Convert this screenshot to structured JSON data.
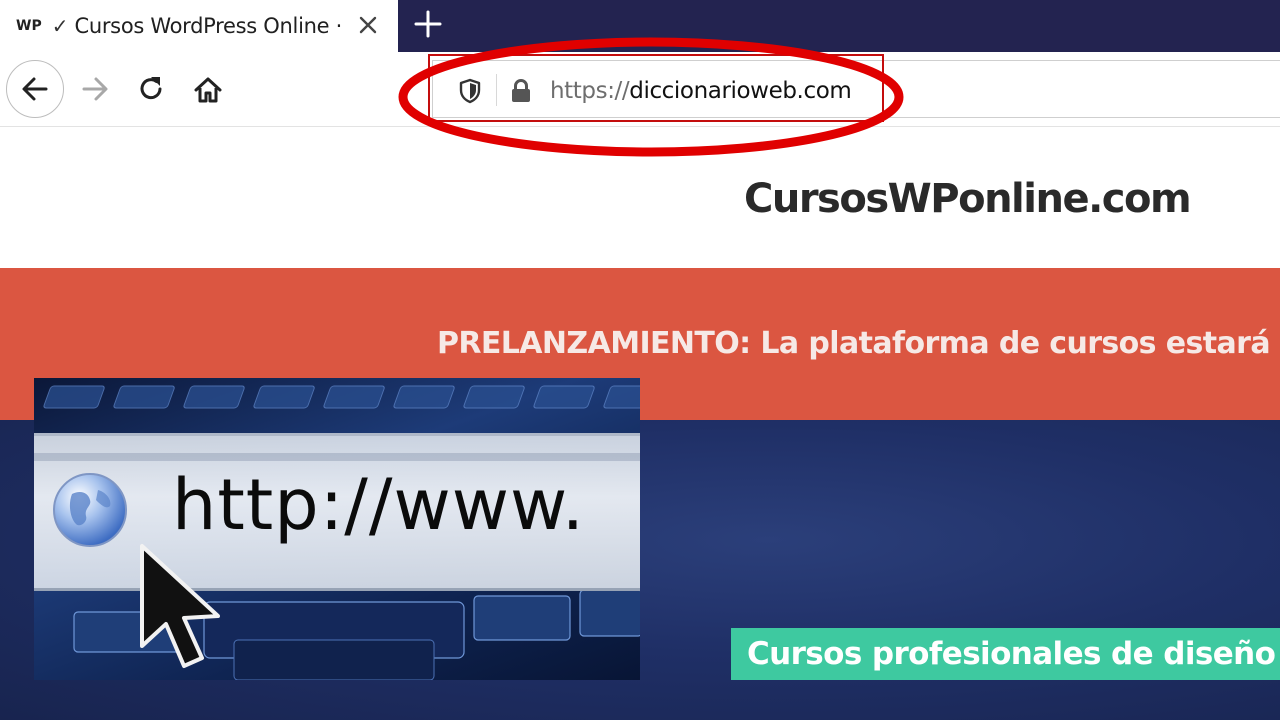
{
  "browser": {
    "tab": {
      "favicon_text": "WP",
      "check_glyph": "✓",
      "title": "Cursos WordPress Online · C"
    },
    "new_tab_symbol": "+",
    "url": {
      "scheme": "https://",
      "host": "diccionarioweb.com"
    },
    "icons": {
      "close": "close-icon",
      "back": "arrow-left-icon",
      "forward": "arrow-right-icon",
      "reload": "reload-icon",
      "home": "home-icon",
      "shield": "shield-icon",
      "lock": "lock-icon"
    }
  },
  "page": {
    "site_logo": "CursosWPonline.com",
    "promo_text": "PRELANZAMIENTO: La plataforma de cursos estará ope",
    "cta_text": "Cursos profesionales de diseño w"
  },
  "overlay": {
    "address_text": "http://www.",
    "icons": [
      "globe-icon",
      "mouse-cursor-icon"
    ]
  },
  "colors": {
    "tabstrip": "#232350",
    "promo_band": "#db5641",
    "hero": "#1f2f66",
    "cta": "#3ec9a0",
    "annotation_red": "#e00000"
  }
}
